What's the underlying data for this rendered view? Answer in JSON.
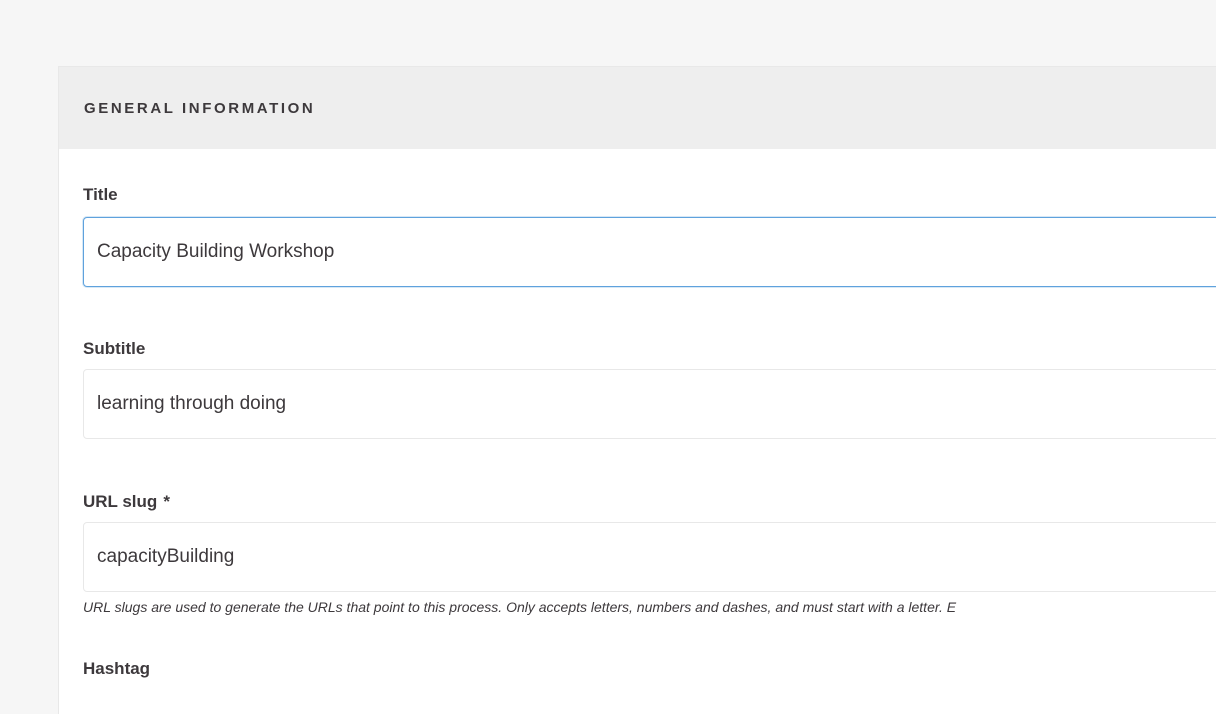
{
  "section": {
    "title": "GENERAL INFORMATION"
  },
  "fields": {
    "title": {
      "label": "Title",
      "value": "Capacity Building Workshop"
    },
    "subtitle": {
      "label": "Subtitle",
      "value": "learning through doing"
    },
    "slug": {
      "label": "URL slug",
      "required_marker": "*",
      "value": "capacityBuilding",
      "help": "URL slugs are used to generate the URLs that point to this process. Only accepts letters, numbers and dashes, and must start with a letter. E"
    },
    "hashtag": {
      "label": "Hashtag"
    }
  },
  "colors": {
    "page_bg": "#f6f6f6",
    "header_bg": "#eeeeee",
    "focus_border": "#5fa2dd",
    "text": "#3d393c"
  }
}
